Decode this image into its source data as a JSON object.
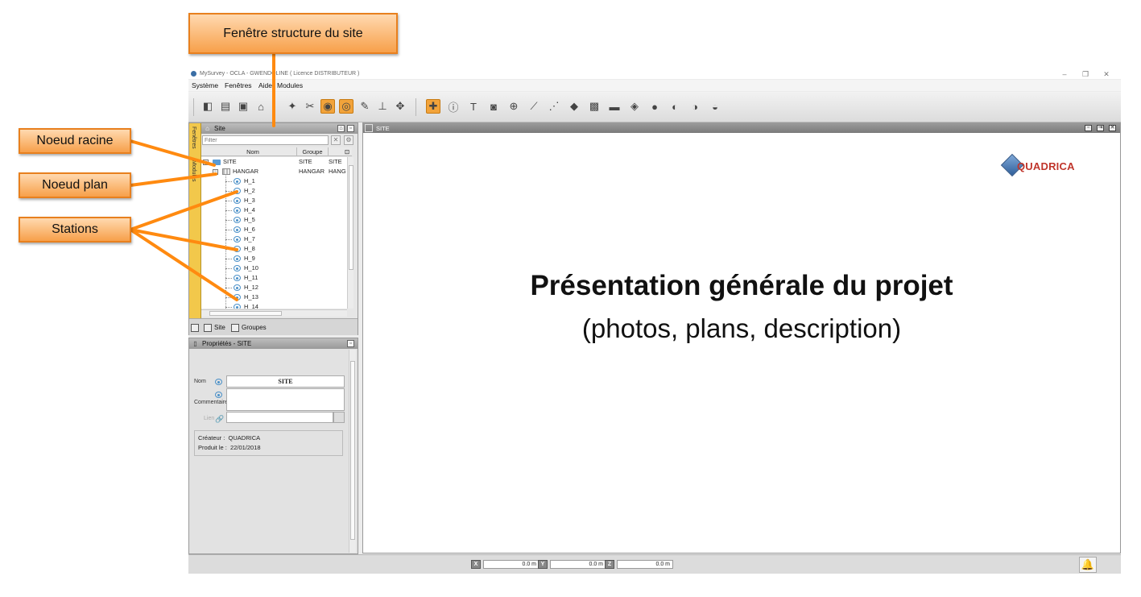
{
  "window": {
    "title": "MySurvey  -  OCLA  -  GWENDOLINE ( Licence DISTRIBUTEUR )",
    "minimize": "–",
    "restore": "❐",
    "close": "✕"
  },
  "menu": [
    "Système",
    "Fenêtres",
    "Aide",
    "Modules"
  ],
  "site_panel": {
    "title": "Site",
    "filter_placeholder": "Filter",
    "side_tabs": [
      "Fenêtres",
      "Modules"
    ],
    "columns": [
      "Nom",
      "Groupe"
    ],
    "root": {
      "name": "SITE",
      "group": "SITE",
      "col3": "SITE"
    },
    "plan": {
      "name": "HANGAR",
      "group": "HANGAR",
      "col3": "HANG"
    },
    "stations": [
      "H_1",
      "H_2",
      "H_3",
      "H_4",
      "H_5",
      "H_6",
      "H_7",
      "H_8",
      "H_9",
      "H_10",
      "H_11",
      "H_12",
      "H_13",
      "H_14"
    ],
    "tabs": [
      "Site",
      "Groupes"
    ]
  },
  "properties": {
    "title": "Propriétés - SITE",
    "name_label": "Nom",
    "name_value": "SITE",
    "comment_label": "Commentaire",
    "link_label": "Lien",
    "creator_label": "Créateur :",
    "creator_value": "QUADRICA",
    "produced_label": "Produit le :",
    "produced_value": "22/01/2018"
  },
  "main_view": {
    "title": "SITE",
    "logo": "QUADRICA",
    "heading": "Présentation générale du projet",
    "subheading": "(photos, plans, description)"
  },
  "status": {
    "x_label": "X",
    "x_value": "0.0 m",
    "y_label": "Y",
    "y_value": "0.0 m",
    "z_label": "Z",
    "z_value": "0.0 m"
  },
  "annotations": {
    "structure_window": "Fenêtre structure du site",
    "root_node": "Noeud racine",
    "plan_node": "Noeud plan",
    "stations": "Stations"
  },
  "colors": {
    "accent_orange": "#f7a04a",
    "arrow_orange": "#ff8a10",
    "side_strip": "#f2c84b",
    "logo_red": "#c0352b",
    "eye_blue": "#4a90c8"
  }
}
